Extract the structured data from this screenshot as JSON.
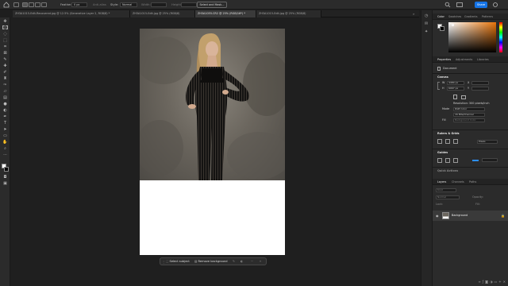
{
  "colors": {
    "accent": "#1473e6",
    "panel": "#2b2b2b",
    "canvas": "#1f1f1f",
    "document": "#ffffff"
  },
  "options_bar": {
    "feather_label": "Feather:",
    "feather_value": "0 px",
    "anti_alias_label": "Anti-alias",
    "style_label": "Style:",
    "style_value": "Normal",
    "width_label": "Width:",
    "height_label": "Height:",
    "select_mask_label": "Select and Mask...",
    "share_label": "Share",
    "icons": [
      "home-icon",
      "marquee-icon",
      "new-selection-icon",
      "search-icon",
      "workspace-icon"
    ]
  },
  "tabs": [
    {
      "label": "ZH3A1015-Edit-Recovered.jpg @ 12.5% (Generative Layer 2, RGB/8) *"
    },
    {
      "label": "ZH3A1015-Edit.jpg @ 25% (RGB/8)"
    },
    {
      "label": "ZH3A1055.CR2 @ 25% (RGB/16*) *"
    },
    {
      "label": "ZH3A1015-Edit.jpg @ 25% (RGB/8)"
    }
  ],
  "tools": [
    "move-tool",
    "marquee-tool",
    "lasso-tool",
    "object-select-tool",
    "crop-tool",
    "frame-tool",
    "eyedropper-tool",
    "spot-healing-tool",
    "brush-tool",
    "clone-stamp-tool",
    "history-brush-tool",
    "eraser-tool",
    "gradient-tool",
    "blur-tool",
    "dodge-tool",
    "pen-tool",
    "type-tool",
    "path-select-tool",
    "rectangle-tool",
    "hand-tool",
    "zoom-tool",
    "more-tools"
  ],
  "taskbar": {
    "select_subject": "Select subject",
    "remove_background": "Remove background"
  },
  "color_panel": {
    "tabs": [
      "Color",
      "Swatches",
      "Gradients",
      "Patterns"
    ],
    "hue_color": "#e8740a"
  },
  "properties_panel": {
    "tabs": [
      "Properties",
      "Adjustments",
      "Libraries"
    ],
    "document_label": "Document",
    "canvas_heading": "Canvas",
    "width_label": "W",
    "width_value": "4480 px",
    "height_label": "H",
    "height_value": "6967 px",
    "x_label": "X",
    "y_label": "Y",
    "resolution": "Resolution: 300 pixels/inch",
    "mode_label": "Mode",
    "mode_value": "RGB Color",
    "depth_value": "16 Bits/Channel",
    "fill_label": "Fill",
    "fill_value": "Background Color",
    "rulers_heading": "Rulers & Grids",
    "units_value": "Pixels",
    "guides_heading": "Guides",
    "quick_actions_heading": "Quick Actions"
  },
  "layers_panel": {
    "tabs": [
      "Layers",
      "Channels",
      "Paths"
    ],
    "kind_placeholder": "Kind",
    "blend_mode": "Normal",
    "opacity_label": "Opacity:",
    "lock_label": "Lock:",
    "fill_label": "Fill:",
    "layers": [
      {
        "name": "Background",
        "visible": true,
        "locked": true
      }
    ]
  }
}
